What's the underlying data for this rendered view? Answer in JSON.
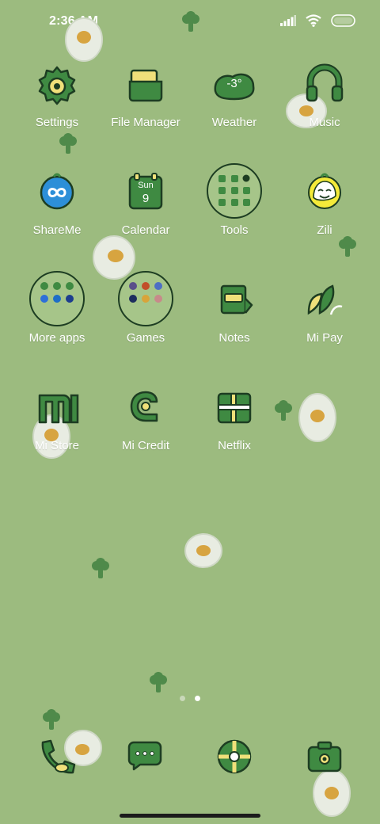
{
  "status": {
    "time": "2:36 AM",
    "icons": [
      "signal-icon",
      "wifi-icon",
      "battery-icon"
    ]
  },
  "apps": [
    {
      "label": "Settings",
      "icon": "settings-icon"
    },
    {
      "label": "File Manager",
      "icon": "folder-icon"
    },
    {
      "label": "Weather",
      "icon": "weather-icon",
      "value": "-3°"
    },
    {
      "label": "Music",
      "icon": "headphones-icon"
    },
    {
      "label": "ShareMe",
      "icon": "shareme-icon"
    },
    {
      "label": "Calendar",
      "icon": "calendar-icon",
      "day": "Sun",
      "date": "9"
    },
    {
      "label": "Tools",
      "icon": "tools-folder-icon"
    },
    {
      "label": "Zili",
      "icon": "zili-icon"
    },
    {
      "label": "More apps",
      "icon": "more-apps-folder-icon"
    },
    {
      "label": "Games",
      "icon": "games-folder-icon"
    },
    {
      "label": "Notes",
      "icon": "notes-icon"
    },
    {
      "label": "Mi Pay",
      "icon": "mi-pay-icon"
    },
    {
      "label": "Mi Store",
      "icon": "mi-store-icon"
    },
    {
      "label": "Mi Credit",
      "icon": "mi-credit-icon"
    },
    {
      "label": "Netflix",
      "icon": "netflix-icon"
    }
  ],
  "dock": [
    {
      "name": "phone",
      "icon": "phone-icon"
    },
    {
      "name": "messages",
      "icon": "messages-icon"
    },
    {
      "name": "browser",
      "icon": "browser-icon"
    },
    {
      "name": "camera",
      "icon": "camera-icon"
    }
  ],
  "pages": {
    "count": 2,
    "active": 2
  },
  "colors": {
    "background": "#9cbb7f",
    "icon_green": "#3f8a42",
    "outline": "#1d3d22",
    "accent_yellow": "#f0e07a",
    "label": "#ffffff"
  }
}
